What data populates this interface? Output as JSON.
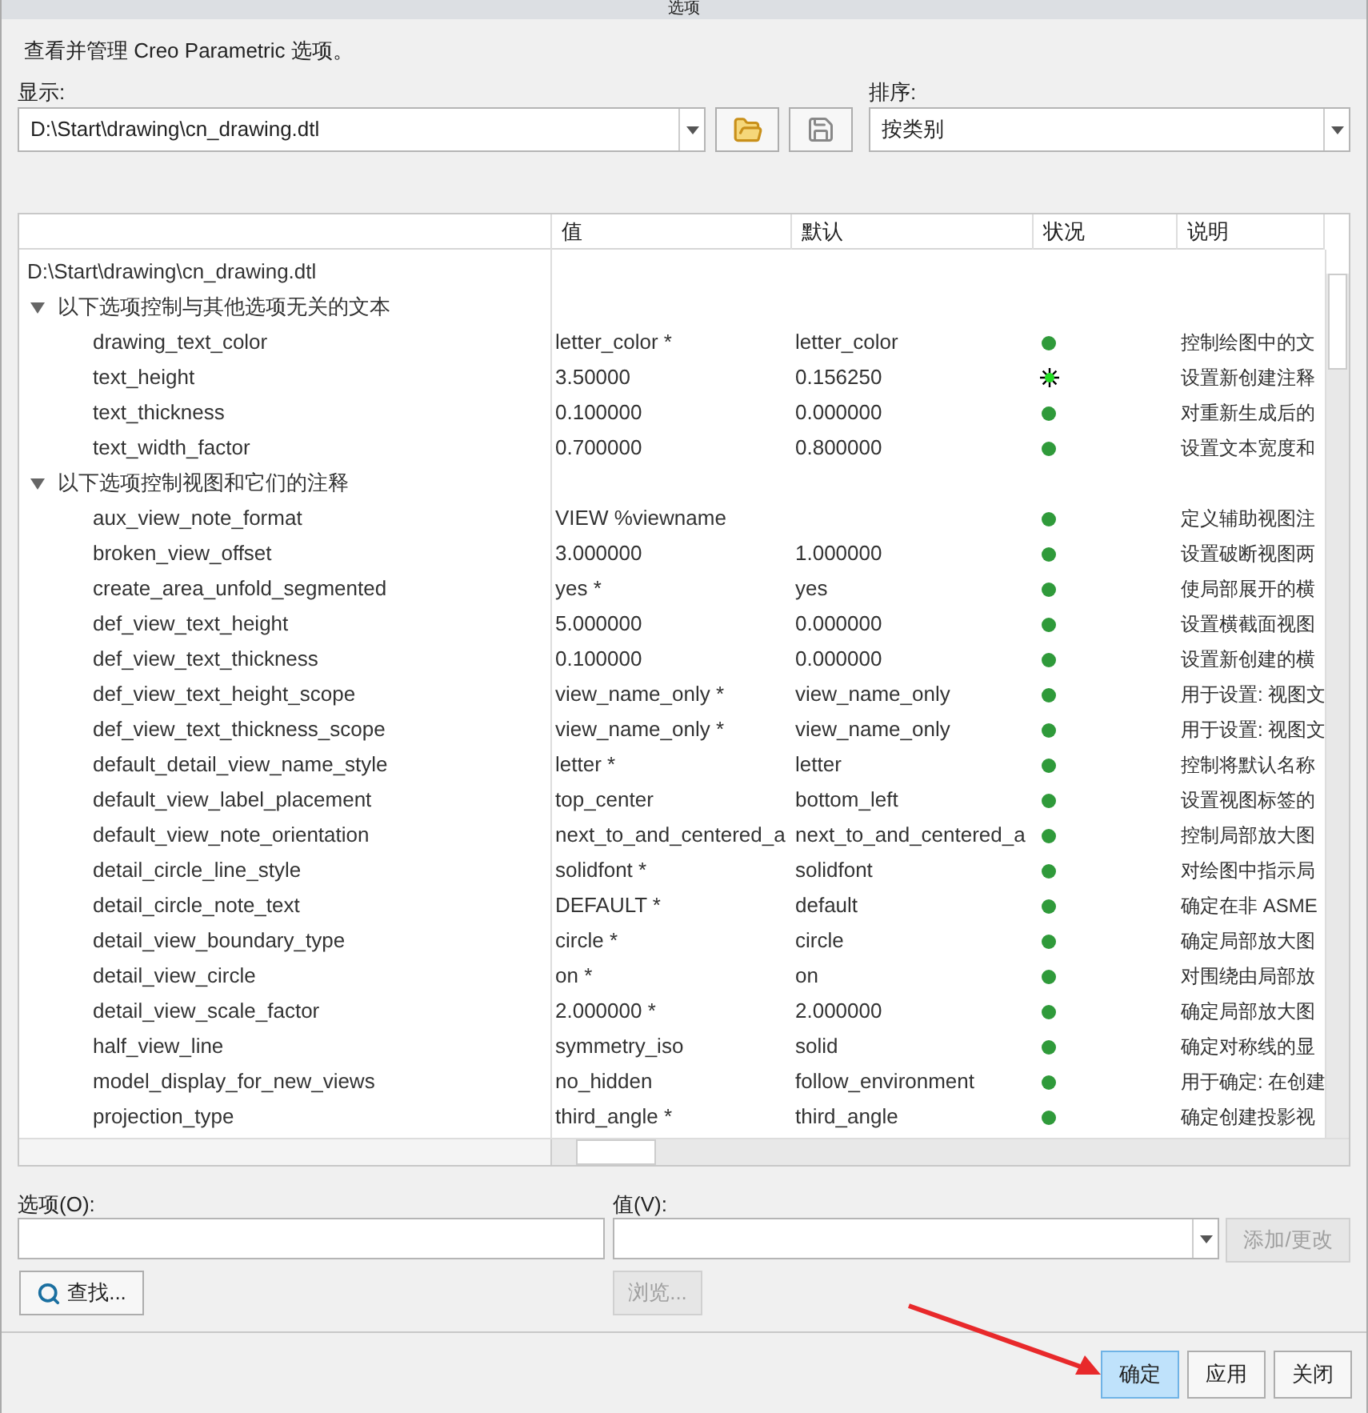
{
  "window": {
    "title": "选项"
  },
  "intro": "查看并管理 Creo Parametric 选项。",
  "display": {
    "label": "显示:",
    "value": "D:\\Start\\drawing\\cn_drawing.dtl"
  },
  "sort": {
    "label": "排序:",
    "value": "按类别"
  },
  "table": {
    "columns": [
      "值",
      "默认",
      "状况",
      "说明"
    ],
    "file": "D:\\Start\\drawing\\cn_drawing.dtl",
    "groups": [
      {
        "title": "以下选项控制与其他选项无关的文本",
        "expanded": true,
        "rows": [
          {
            "name": "drawing_text_color",
            "value": "letter_color *",
            "default": "letter_color",
            "kind": "ok",
            "description": "控制绘图中的文"
          },
          {
            "name": "text_height",
            "value": "3.50000",
            "default": "0.156250",
            "kind": "modified",
            "description": "设置新创建注释"
          },
          {
            "name": "text_thickness",
            "value": "0.100000",
            "default": "0.000000",
            "kind": "ok",
            "description": "对重新生成后的"
          },
          {
            "name": "text_width_factor",
            "value": "0.700000",
            "default": "0.800000",
            "kind": "ok",
            "description": "设置文本宽度和"
          }
        ]
      },
      {
        "title": "以下选项控制视图和它们的注释",
        "expanded": true,
        "rows": [
          {
            "name": "aux_view_note_format",
            "value": "VIEW %viewname",
            "kind": "ok",
            "description": "定义辅助视图注"
          },
          {
            "name": "broken_view_offset",
            "value": "3.000000",
            "default": "1.000000",
            "kind": "ok",
            "description": "设置破断视图两"
          },
          {
            "name": "create_area_unfold_segmented",
            "value": "yes *",
            "default": "yes",
            "kind": "ok",
            "description": "使局部展开的横"
          },
          {
            "name": "def_view_text_height",
            "value": "5.000000",
            "default": "0.000000",
            "kind": "ok",
            "description": "设置横截面视图"
          },
          {
            "name": "def_view_text_thickness",
            "value": "0.100000",
            "default": "0.000000",
            "kind": "ok",
            "description": "设置新创建的横"
          },
          {
            "name": "def_view_text_height_scope",
            "value": "view_name_only *",
            "default": "view_name_only",
            "kind": "ok",
            "description": "用于设置: 视图文"
          },
          {
            "name": "def_view_text_thickness_scope",
            "value": "view_name_only *",
            "default": "view_name_only",
            "kind": "ok",
            "description": "用于设置: 视图文"
          },
          {
            "name": "default_detail_view_name_style",
            "value": "letter *",
            "default": "letter",
            "kind": "ok",
            "description": "控制将默认名称"
          },
          {
            "name": "default_view_label_placement",
            "value": "top_center",
            "default": "bottom_left",
            "kind": "ok",
            "description": "设置视图标签的"
          },
          {
            "name": "default_view_note_orientation",
            "value": "next_to_and_centered_a",
            "default": "next_to_and_centered_a",
            "kind": "ok",
            "description": "控制局部放大图"
          },
          {
            "name": "detail_circle_line_style",
            "value": "solidfont *",
            "default": "solidfont",
            "kind": "ok",
            "description": "对绘图中指示局"
          },
          {
            "name": "detail_circle_note_text",
            "value": "DEFAULT *",
            "default": "default",
            "kind": "ok",
            "description": "确定在非 ASME"
          },
          {
            "name": "detail_view_boundary_type",
            "value": "circle *",
            "default": "circle",
            "kind": "ok",
            "description": "确定局部放大图"
          },
          {
            "name": "detail_view_circle",
            "value": "on *",
            "default": "on",
            "kind": "ok",
            "description": "对围绕由局部放"
          },
          {
            "name": "detail_view_scale_factor",
            "value": "2.000000 *",
            "default": "2.000000",
            "kind": "ok",
            "description": "确定局部放大图"
          },
          {
            "name": "half_view_line",
            "value": "symmetry_iso",
            "default": "solid",
            "kind": "ok",
            "description": "确定对称线的显"
          },
          {
            "name": "model_display_for_new_views",
            "value": "no_hidden",
            "default": "follow_environment",
            "kind": "ok",
            "description": "用于确定: 在创建"
          },
          {
            "name": "projection_type",
            "value": "third_angle *",
            "default": "third_angle",
            "kind": "ok",
            "description": "确定创建投影视"
          }
        ]
      }
    ]
  },
  "option_field": {
    "label": "选项(O):"
  },
  "value_field": {
    "label": "值(V):"
  },
  "add_button": {
    "label": "添加/更改",
    "disabled": true
  },
  "find_button": {
    "label": "查找..."
  },
  "browse_button": {
    "label": "浏览...",
    "disabled": true
  },
  "footer_buttons": [
    {
      "label": "确定",
      "default": true
    },
    {
      "label": "应用",
      "default": false
    },
    {
      "label": "关闭",
      "default": false
    }
  ]
}
